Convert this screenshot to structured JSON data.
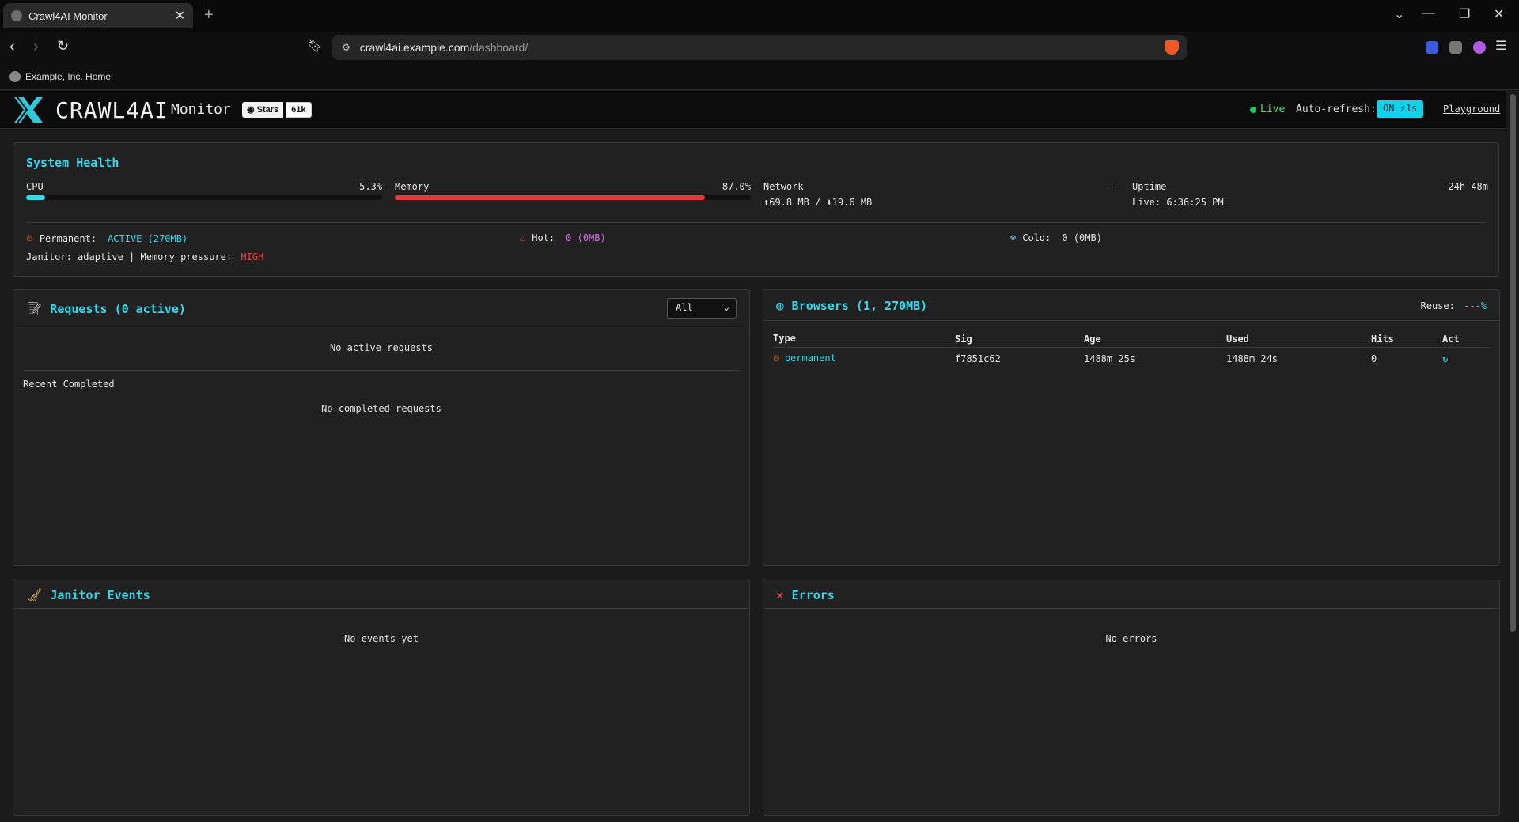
{
  "browser": {
    "tab_title": "Crawl4AI Monitor",
    "url_host": "crawl4ai.example.com",
    "url_path": "/dashboard/",
    "bookmark": "Example, Inc. Home"
  },
  "header": {
    "brand": "CRAWL4AI",
    "subtitle": "Monitor",
    "stars_label": "Stars",
    "stars_count": "61k",
    "live": "Live",
    "auto_refresh_label": "Auto-refresh:",
    "auto_refresh_value": "ON ⚡1s",
    "playground": "Playground"
  },
  "health": {
    "title": "System Health",
    "cpu_label": "CPU",
    "cpu_value": "5.3%",
    "cpu_fraction": 0.053,
    "memory_label": "Memory",
    "memory_value": "87.0%",
    "memory_fraction": 0.87,
    "network_label": "Network",
    "network_value": "--",
    "network_io": "⬆69.8 MB / ⬇19.6 MB",
    "uptime_label": "Uptime",
    "uptime_value": "24h 48m",
    "uptime_live": "Live: 6:36:25 PM",
    "permanent_label": "Permanent:",
    "permanent_value": "ACTIVE (270MB)",
    "hot_label": "Hot:",
    "hot_value": "0 (0MB)",
    "cold_label": "Cold:",
    "cold_value": "0 (0MB)",
    "janitor_line": "Janitor: adaptive | Memory pressure:",
    "pressure_value": "HIGH"
  },
  "requests": {
    "title": "Requests (0 active)",
    "filter": "All",
    "empty_active": "No active requests",
    "recent_label": "Recent Completed",
    "empty_completed": "No completed requests"
  },
  "browsers": {
    "title": "Browsers (1, 270MB)",
    "reuse_label": "Reuse:",
    "reuse_value": "---%",
    "columns": [
      "Type",
      "Sig",
      "Age",
      "Used",
      "Hits",
      "Act"
    ],
    "rows": [
      {
        "type": "permanent",
        "sig": "f7851c62",
        "age": "1488m 25s",
        "used": "1488m 24s",
        "hits": "0",
        "act": "↻"
      }
    ]
  },
  "janitor": {
    "title": "Janitor Events",
    "empty": "No events yet"
  },
  "errors": {
    "title": "Errors",
    "empty": "No errors"
  },
  "colors": {
    "accent": "#33d9ef",
    "memory_bar": "#e03c3c",
    "cpu_bar": "#33d9ef",
    "live_green": "#22c55e",
    "hot_magenta": "#d070e0",
    "pressure_red": "#ef4444"
  }
}
